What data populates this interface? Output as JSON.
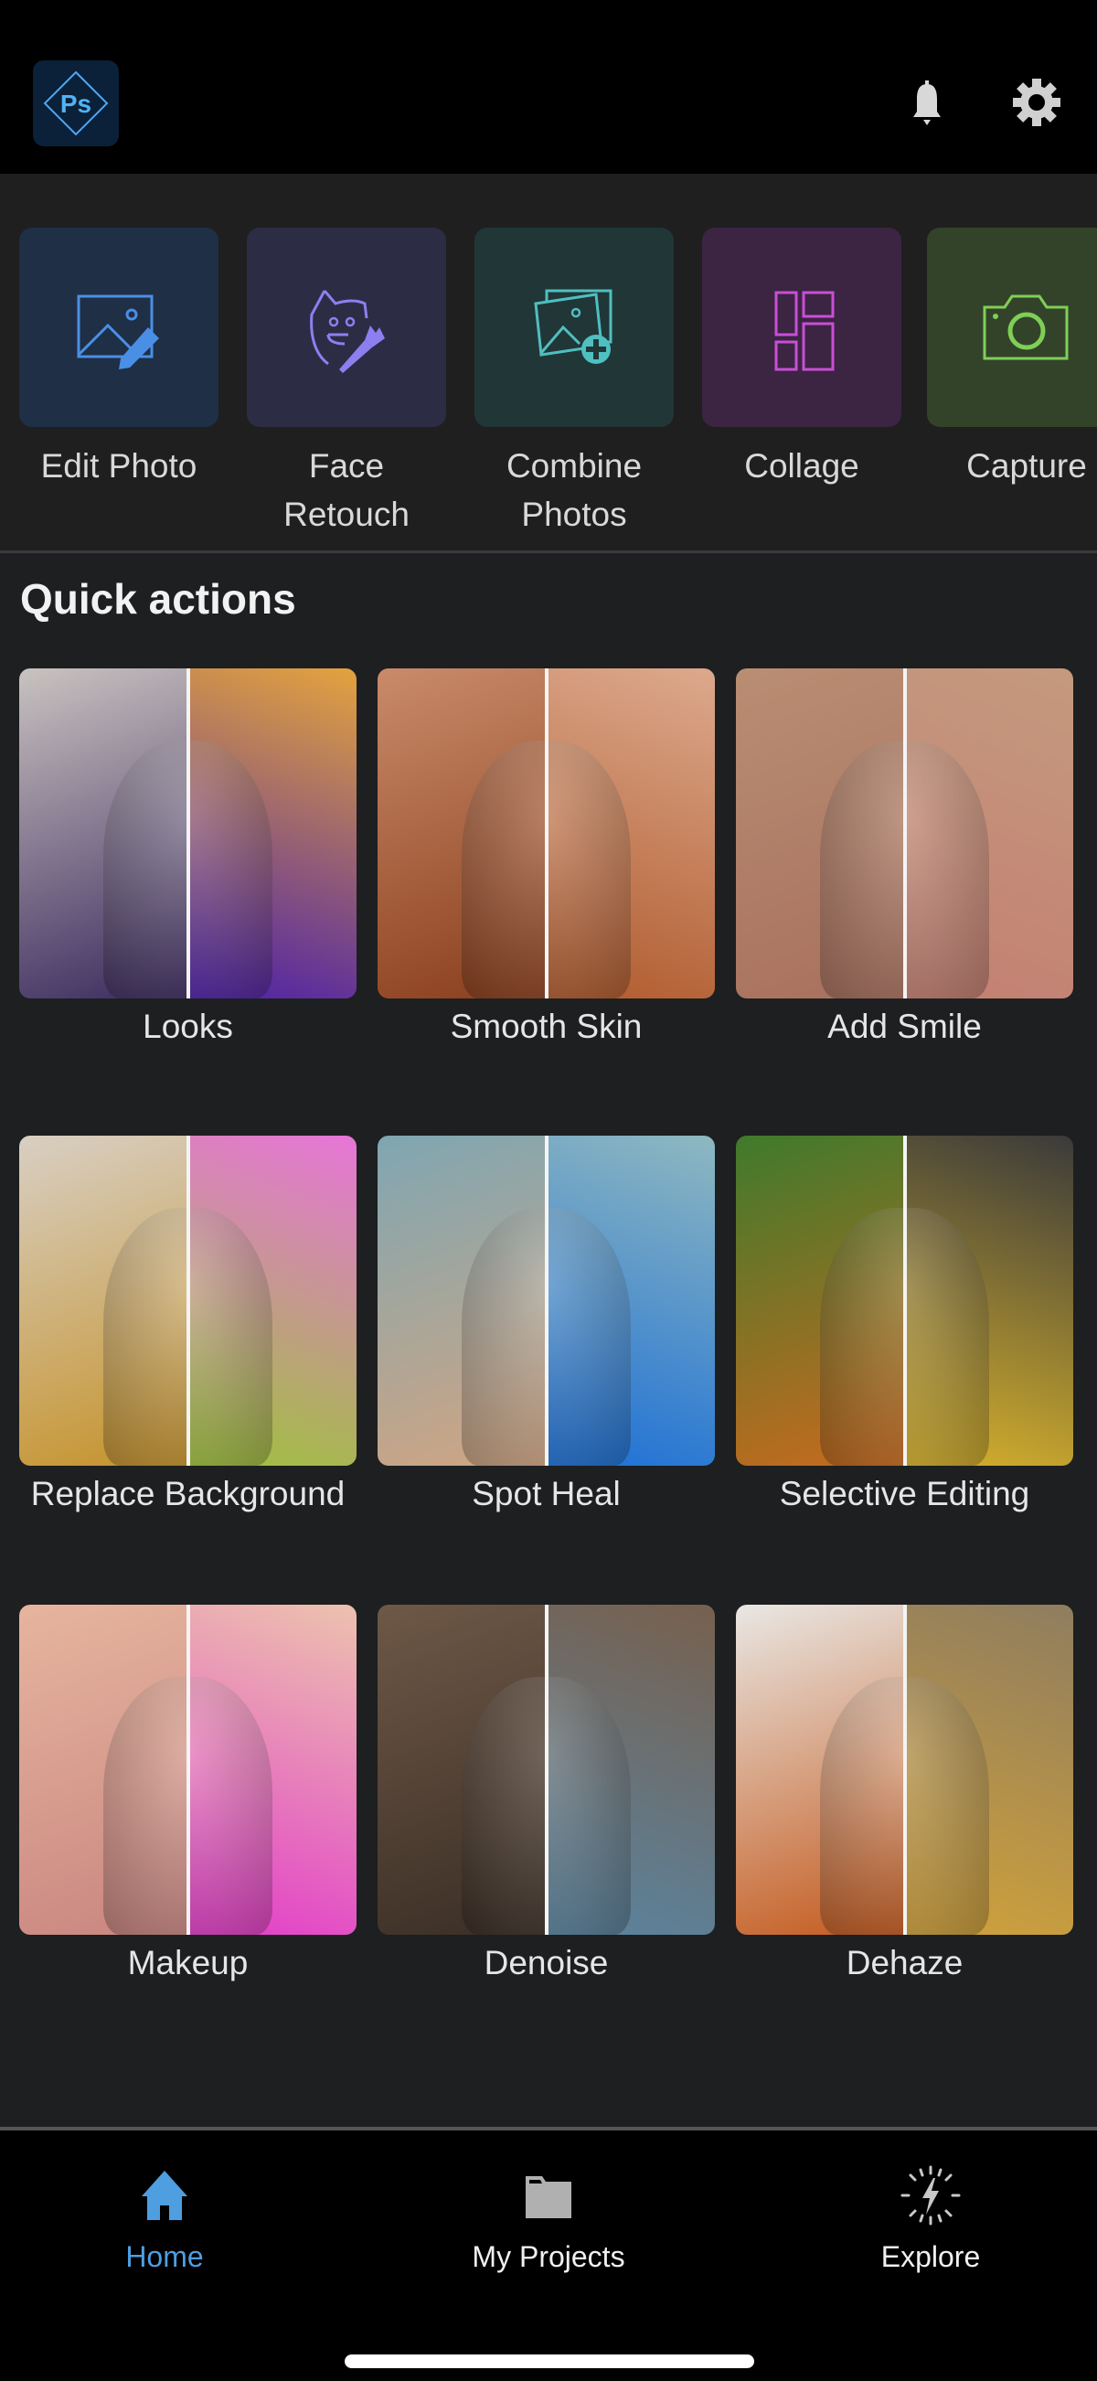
{
  "header": {
    "logo_text": "Ps",
    "icons": [
      "notification-bell-icon",
      "settings-gear-icon"
    ]
  },
  "tools": [
    {
      "label_line1": "Edit Photo",
      "label_line2": "",
      "icon": "edit-photo-icon",
      "bg": "#1f2f45",
      "fg": "#4a8fe6"
    },
    {
      "label_line1": "Face",
      "label_line2": "Retouch",
      "icon": "face-retouch-icon",
      "bg": "#2d2c45",
      "fg": "#8f7ef0"
    },
    {
      "label_line1": "Combine",
      "label_line2": "Photos",
      "icon": "combine-photos-icon",
      "bg": "#213637",
      "fg": "#4fbfc0"
    },
    {
      "label_line1": "Collage",
      "label_line2": "",
      "icon": "collage-icon",
      "bg": "#3c2443",
      "fg": "#c84fd6"
    },
    {
      "label_line1": "Capture",
      "label_line2": "",
      "icon": "camera-icon",
      "bg": "#33432a",
      "fg": "#7fcf55"
    }
  ],
  "quick_actions": {
    "title": "Quick actions",
    "items": [
      {
        "label": "Looks",
        "left": "#c9c3c0",
        "right": "#e3a33e",
        "accent": "#3b2a5e",
        "accent2": "#4b1fa8"
      },
      {
        "label": "Smooth Skin",
        "left": "#c98b6a",
        "right": "#dca98d",
        "accent": "#8a3e1c",
        "accent2": "#b05a2c"
      },
      {
        "label": "Add Smile",
        "left": "#b98e73",
        "right": "#c49a7e",
        "accent": "#a8705e",
        "accent2": "#c47f72"
      },
      {
        "label": "Replace Background",
        "left": "#d8cfc4",
        "right": "#e775d8",
        "accent": "#c5922a",
        "accent2": "#9ec13b"
      },
      {
        "label": "Spot Heal",
        "left": "#7fa6b2",
        "right": "#8fb8c0",
        "accent": "#d1a582",
        "accent2": "#1c6fd6"
      },
      {
        "label": "Selective Editing",
        "left": "#3f7a2c",
        "right": "#3a3a3a",
        "accent": "#c96a1e",
        "accent2": "#d9b32c"
      },
      {
        "label": "Makeup",
        "left": "#e6b59e",
        "right": "#edc2ae",
        "accent": "#c98580",
        "accent2": "#e23cc9"
      },
      {
        "label": "Denoise",
        "left": "#6e5847",
        "right": "#77604e",
        "accent": "#3a2e25",
        "accent2": "#5a84a0"
      },
      {
        "label": "Dehaze",
        "left": "#e9e7e4",
        "right": "#8f7d5f",
        "accent": "#c4591c",
        "accent2": "#d1a23a"
      }
    ]
  },
  "bottom_nav": [
    {
      "label": "Home",
      "icon": "home-icon",
      "active": true
    },
    {
      "label": "My Projects",
      "icon": "folder-icon",
      "active": false
    },
    {
      "label": "Explore",
      "icon": "explore-lightning-icon",
      "active": false
    }
  ]
}
